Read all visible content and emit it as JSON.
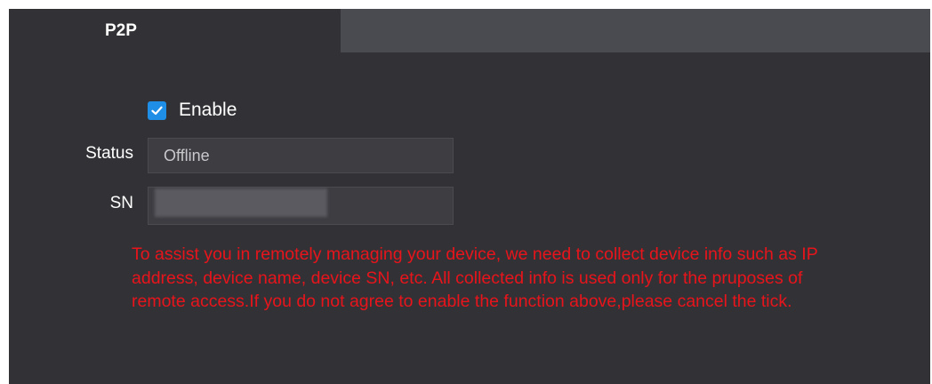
{
  "tab": {
    "label": "P2P"
  },
  "enable": {
    "label": "Enable",
    "checked": true
  },
  "status": {
    "label": "Status",
    "value": "Offline"
  },
  "sn": {
    "label": "SN",
    "value": ""
  },
  "notice": {
    "text": "To assist you in remotely managing your device, we need to collect device info such as IP address, device name, device SN, etc. All collected info is used only for the pruposes of remote access.If you do not agree to enable the function above,please cancel the tick."
  },
  "colors": {
    "panel_background": "#323236",
    "tab_strip": "#4a4a51",
    "checkbox_accent": "#1f8ee6",
    "notice_text": "#e8141b"
  },
  "icons": {
    "checkbox": "check-icon"
  }
}
